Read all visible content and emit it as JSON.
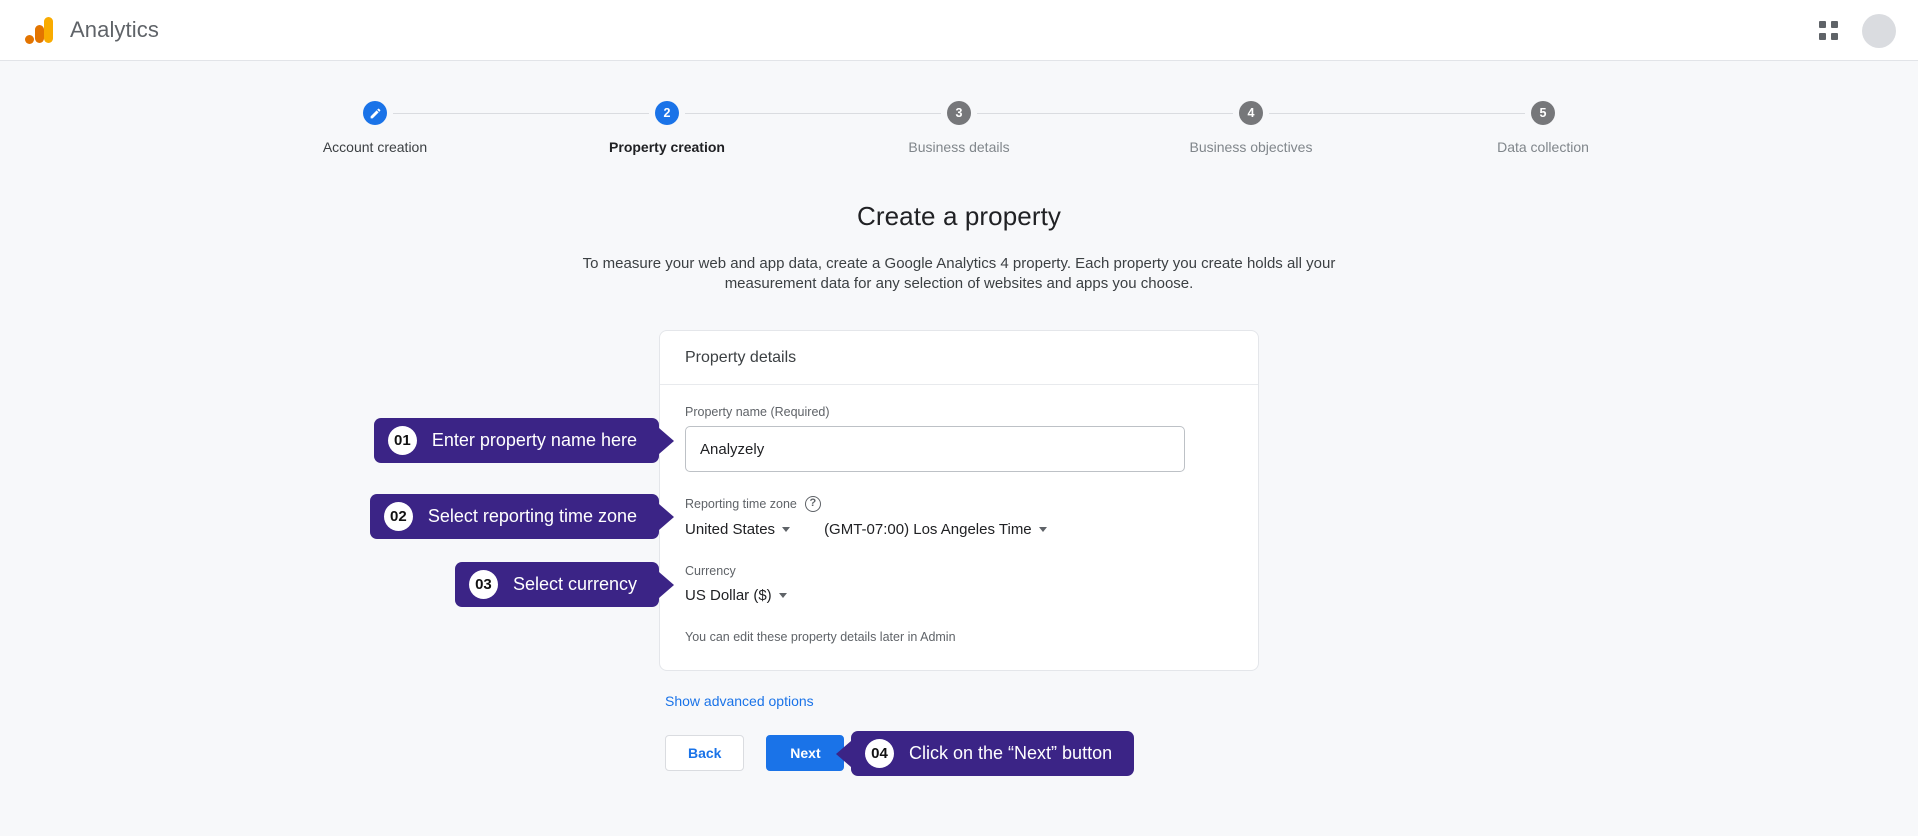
{
  "header": {
    "brand": "Analytics",
    "logo_icon": "google-analytics-logo",
    "apps_icon": "apps-grid-icon",
    "avatar_icon": "user-avatar",
    "logo_colors": {
      "tall": "#f9ab00",
      "mid": "#e37400",
      "dot": "#e37400"
    }
  },
  "stepper": {
    "steps": [
      {
        "num": "1",
        "label": "Account creation",
        "state": "done",
        "icon": "pencil-icon"
      },
      {
        "num": "2",
        "label": "Property creation",
        "state": "active",
        "icon": ""
      },
      {
        "num": "3",
        "label": "Business details",
        "state": "pending",
        "icon": ""
      },
      {
        "num": "4",
        "label": "Business objectives",
        "state": "pending",
        "icon": ""
      },
      {
        "num": "5",
        "label": "Data collection",
        "state": "pending",
        "icon": ""
      }
    ],
    "active_color": "#1a73e8",
    "pending_color": "#76777a"
  },
  "page": {
    "title": "Create a property",
    "description": "To measure your web and app data, create a Google Analytics 4 property. Each property you create holds all your measurement data for any selection of websites and apps you choose."
  },
  "card": {
    "title": "Property details",
    "property_name": {
      "label": "Property name (Required)",
      "value": "Analyzely",
      "placeholder": "Property name"
    },
    "time_zone": {
      "label": "Reporting time zone",
      "help_icon": "help-circle-icon",
      "country": "United States",
      "zone": "(GMT-07:00) Los Angeles Time"
    },
    "currency": {
      "label": "Currency",
      "value": "US Dollar ($)"
    },
    "hint": "You can edit these property details later in Admin"
  },
  "actions": {
    "advanced_link": "Show advanced options",
    "back_label": "Back",
    "next_label": "Next",
    "next_color": "#1a73e8",
    "link_color": "#1a73e8"
  },
  "callouts": {
    "color": "#3b2486",
    "items": [
      {
        "num": "01",
        "text": "Enter property name here"
      },
      {
        "num": "02",
        "text": "Select reporting time zone"
      },
      {
        "num": "03",
        "text": "Select currency"
      },
      {
        "num": "04",
        "text": "Click on the “Next” button"
      }
    ]
  }
}
